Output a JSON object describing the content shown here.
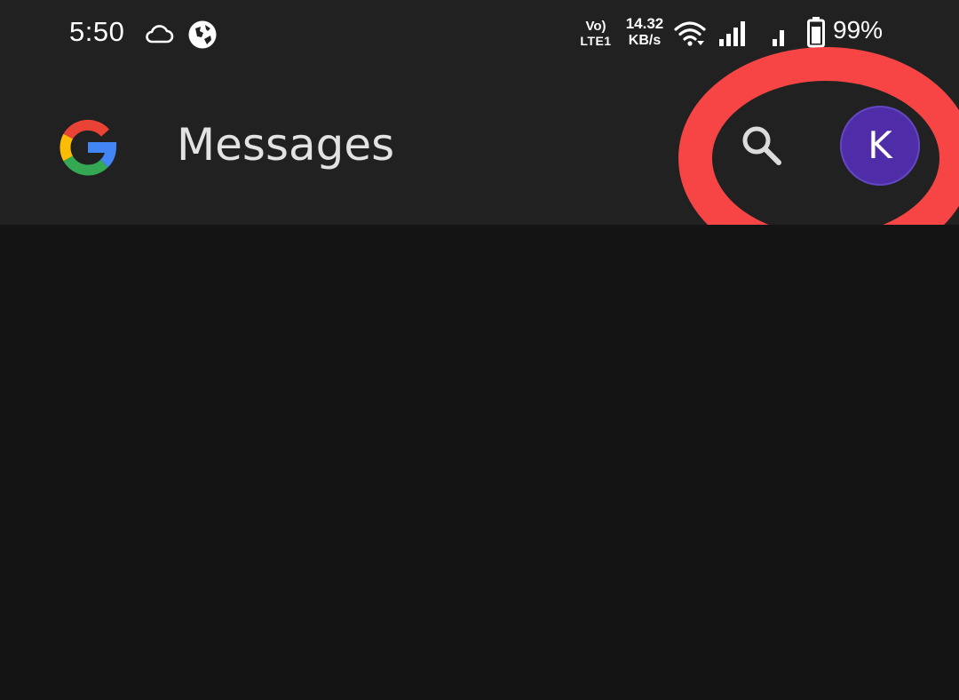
{
  "status_bar": {
    "time": "5:50",
    "icons": [
      "cloud-icon",
      "vpn-icon",
      "volte-icon",
      "wifi-icon",
      "signal-icon",
      "signal-icon",
      "battery-icon"
    ],
    "volte_top": "Vo)",
    "volte_bottom": "LTE1",
    "net_speed_value": "14.32",
    "net_speed_unit": "KB/s",
    "battery_text": "99%"
  },
  "app_bar": {
    "logo": "google-g-logo",
    "title": "Messages",
    "search_icon": "search-icon",
    "avatar_letter": "K"
  },
  "colors": {
    "status_bar_bg": "#212121",
    "app_bar_bg": "#212121",
    "content_bg": "#141414",
    "avatar_bg": "#4f2ca8",
    "highlight_ring": "#f74545",
    "title_text": "#e3e3e3"
  }
}
